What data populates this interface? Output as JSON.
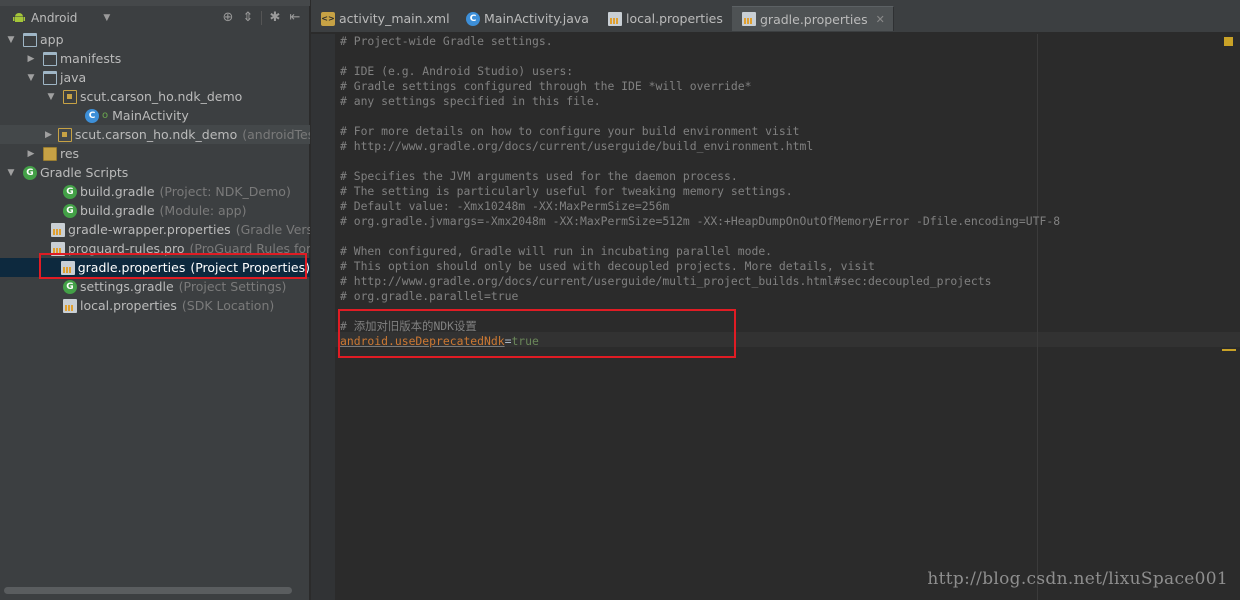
{
  "project_panel": {
    "view_selector": "Android",
    "tree": [
      {
        "label": "app",
        "hint": "",
        "icon": "module-folder-icon",
        "arrow": "▼",
        "indent": 0,
        "state": "normal"
      },
      {
        "label": "manifests",
        "hint": "",
        "icon": "folder-icon",
        "arrow": "▶",
        "indent": 1,
        "state": "normal"
      },
      {
        "label": "java",
        "hint": "",
        "icon": "folder-icon",
        "arrow": "▼",
        "indent": 1,
        "state": "normal"
      },
      {
        "label": "scut.carson_ho.ndk_demo",
        "hint": "",
        "icon": "package-icon",
        "arrow": "▼",
        "indent": 2,
        "state": "normal"
      },
      {
        "label": "MainActivity",
        "hint": "",
        "icon": "class-icon",
        "arrow": "",
        "indent": 4,
        "state": "normal"
      },
      {
        "label": "scut.carson_ho.ndk_demo",
        "hint": "(androidTest)",
        "icon": "package-icon",
        "arrow": "▶",
        "indent": 2,
        "state": "highlight"
      },
      {
        "label": "res",
        "hint": "",
        "icon": "res-folder-icon",
        "arrow": "▶",
        "indent": 1,
        "state": "normal"
      },
      {
        "label": "Gradle Scripts",
        "hint": "",
        "icon": "gradle-icon",
        "arrow": "▼",
        "indent": 0,
        "state": "normal"
      },
      {
        "label": "build.gradle",
        "hint": "(Project: NDK_Demo)",
        "icon": "gradle-icon",
        "arrow": "",
        "indent": 2,
        "state": "normal"
      },
      {
        "label": "build.gradle",
        "hint": "(Module: app)",
        "icon": "gradle-icon",
        "arrow": "",
        "indent": 2,
        "state": "normal"
      },
      {
        "label": "gradle-wrapper.properties",
        "hint": "(Gradle Version)",
        "icon": "properties-icon",
        "arrow": "",
        "indent": 2,
        "state": "normal"
      },
      {
        "label": "proguard-rules.pro",
        "hint": "(ProGuard Rules for app)",
        "icon": "properties-icon",
        "arrow": "",
        "indent": 2,
        "state": "normal"
      },
      {
        "label": "gradle.properties",
        "hint": "(Project Properties)",
        "icon": "properties-icon",
        "arrow": "",
        "indent": 2,
        "state": "selected"
      },
      {
        "label": "settings.gradle",
        "hint": "(Project Settings)",
        "icon": "gradle-icon",
        "arrow": "",
        "indent": 2,
        "state": "normal"
      },
      {
        "label": "local.properties",
        "hint": "(SDK Location)",
        "icon": "properties-icon",
        "arrow": "",
        "indent": 2,
        "state": "normal"
      }
    ]
  },
  "tabs": [
    {
      "label": "activity_main.xml",
      "icon": "xml-file-icon",
      "active": false
    },
    {
      "label": "MainActivity.java",
      "icon": "class-icon",
      "active": false
    },
    {
      "label": "local.properties",
      "icon": "properties-icon",
      "active": false
    },
    {
      "label": "gradle.properties",
      "icon": "properties-icon",
      "active": true
    }
  ],
  "editor": {
    "lines": [
      {
        "type": "comment",
        "text": "# Project-wide Gradle settings."
      },
      {
        "type": "blank",
        "text": ""
      },
      {
        "type": "comment",
        "text": "# IDE (e.g. Android Studio) users:"
      },
      {
        "type": "comment",
        "text": "# Gradle settings configured through the IDE *will override*"
      },
      {
        "type": "comment",
        "text": "# any settings specified in this file."
      },
      {
        "type": "blank",
        "text": ""
      },
      {
        "type": "comment",
        "text": "# For more details on how to configure your build environment visit"
      },
      {
        "type": "comment",
        "text": "# http://www.gradle.org/docs/current/userguide/build_environment.html"
      },
      {
        "type": "blank",
        "text": ""
      },
      {
        "type": "comment",
        "text": "# Specifies the JVM arguments used for the daemon process."
      },
      {
        "type": "comment",
        "text": "# The setting is particularly useful for tweaking memory settings."
      },
      {
        "type": "comment",
        "text": "# Default value: -Xmx10248m -XX:MaxPermSize=256m"
      },
      {
        "type": "comment",
        "text": "# org.gradle.jvmargs=-Xmx2048m -XX:MaxPermSize=512m -XX:+HeapDumpOnOutOfMemoryError -Dfile.encoding=UTF-8"
      },
      {
        "type": "blank",
        "text": ""
      },
      {
        "type": "comment",
        "text": "# When configured, Gradle will run in incubating parallel mode."
      },
      {
        "type": "comment",
        "text": "# This option should only be used with decoupled projects. More details, visit"
      },
      {
        "type": "comment",
        "text": "# http://www.gradle.org/docs/current/userguide/multi_project_builds.html#sec:decoupled_projects"
      },
      {
        "type": "comment",
        "text": "# org.gradle.parallel=true"
      },
      {
        "type": "blank",
        "text": ""
      },
      {
        "type": "comment",
        "text": "# 添加对旧版本的NDK设置"
      },
      {
        "type": "property",
        "key": "android.useDeprecatedNdk",
        "eq": "=",
        "value": "true"
      }
    ]
  },
  "watermark": "http://blog.csdn.net/lixuSpace001",
  "colors": {
    "annotation_red": "#e01c24",
    "selection_blue": "#0d293e",
    "property_key": "#cc7832",
    "property_value": "#6a8759"
  }
}
